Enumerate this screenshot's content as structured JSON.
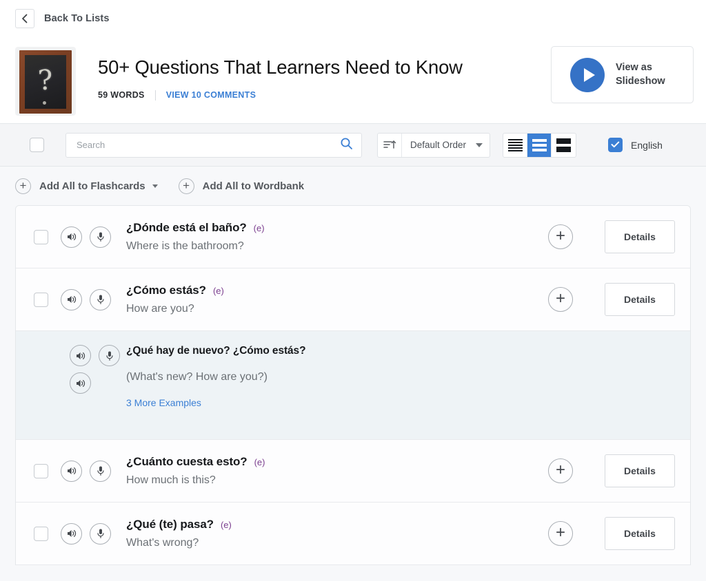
{
  "backbar": {
    "label": "Back To Lists",
    "icon": "chevron-left-icon"
  },
  "header": {
    "thumbnail_alt": "chalkboard-question-mark",
    "title": "50+ Questions That Learners Need to Know",
    "word_count": "59 WORDS",
    "comments_link": "VIEW 10 COMMENTS",
    "slideshow_label": "View as\nSlideshow",
    "slideshow_line1": "View as",
    "slideshow_line2": "Slideshow",
    "accent_blue": "#3572c6"
  },
  "toolbar": {
    "search_placeholder": "Search",
    "search_value": "",
    "sort_label": "Default Order",
    "view_modes": [
      {
        "name": "compact",
        "active": false
      },
      {
        "name": "medium",
        "active": true
      },
      {
        "name": "large",
        "active": false
      }
    ],
    "language_label": "English",
    "language_checked": true,
    "select_all_checked": false
  },
  "actions": {
    "add_flashcards_label": "Add All to Flashcards",
    "add_wordbank_label": "Add All to Wordbank"
  },
  "list": {
    "details_label": "Details",
    "items": [
      {
        "term": "¿Dónde está el baño?",
        "tag": "(e)",
        "translation": "Where is the bathroom?",
        "expanded": false
      },
      {
        "term": "¿Cómo estás?",
        "tag": "(e)",
        "translation": "How are you?",
        "expanded": false
      },
      {
        "term": "¿Qué hay de nuevo? ¿Cómo estás?",
        "tag": "",
        "translation": "(What's new? How are you?)",
        "more_examples": "3 More Examples",
        "expanded": true
      },
      {
        "term": "¿Cuánto cuesta esto?",
        "tag": "(e)",
        "translation": "How much is this?",
        "expanded": false
      },
      {
        "term": "¿Qué (te) pasa?",
        "tag": "(e)",
        "translation": "What's wrong?",
        "expanded": false
      }
    ]
  },
  "colors": {
    "link_blue": "#3b7fd4",
    "tag_purple": "#7b3f8f",
    "highlight_bg": "#eef3f6"
  }
}
